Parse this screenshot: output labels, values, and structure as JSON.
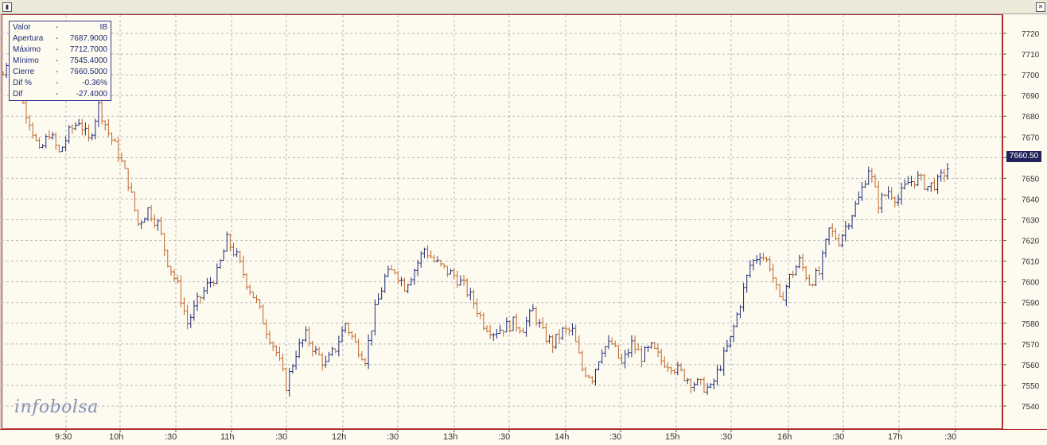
{
  "window": {
    "icon": "window-icon"
  },
  "info_box": {
    "rows": [
      {
        "label": "Valor",
        "value": "IB"
      },
      {
        "label": "Apertura",
        "value": "7687.9000"
      },
      {
        "label": "Máximo",
        "value": "7712.7000"
      },
      {
        "label": "Mínimo",
        "value": "7545.4000"
      },
      {
        "label": "Cierre",
        "value": "7660.5000"
      },
      {
        "label": "Dif %",
        "value": "-0.36%"
      },
      {
        "label": "Dif",
        "value": "-27.4000"
      }
    ]
  },
  "logo": {
    "part1": "info",
    "part2": "bolsa"
  },
  "last_price_label": "7660.50",
  "colors": {
    "up": "#1f2a7a",
    "down": "#c0652a",
    "grid": "#b8b8b8",
    "frame": "#b03030"
  },
  "chart_data": {
    "type": "ohlc",
    "y_ticks": [
      "7720",
      "7710",
      "7700",
      "7690",
      "7680",
      "7670",
      "7660",
      "7650",
      "7640",
      "7630",
      "7620",
      "7610",
      "7600",
      "7590",
      "7580",
      "7570",
      "7560",
      "7550",
      "7540"
    ],
    "ylim": [
      7535,
      7725
    ],
    "x_ticks": [
      "9:30",
      "10h",
      ":30",
      "11h",
      ":30",
      "12h",
      ":30",
      "13h",
      ":30",
      "14h",
      ":30",
      "15h",
      ":30",
      "16h",
      ":30",
      "17h",
      ":30"
    ],
    "open": 7687.9,
    "high": 7712.7,
    "low": 7545.4,
    "close": 7660.5,
    "path_points": [
      [
        0,
        7700
      ],
      [
        2,
        7712
      ],
      [
        5,
        7690
      ],
      [
        8,
        7678
      ],
      [
        11,
        7662
      ],
      [
        14,
        7672
      ],
      [
        17,
        7662
      ],
      [
        20,
        7672
      ],
      [
        23,
        7678
      ],
      [
        26,
        7668
      ],
      [
        29,
        7685
      ],
      [
        32,
        7672
      ],
      [
        35,
        7662
      ],
      [
        38,
        7648
      ],
      [
        41,
        7628
      ],
      [
        44,
        7635
      ],
      [
        47,
        7628
      ],
      [
        50,
        7610
      ],
      [
        53,
        7598
      ],
      [
        56,
        7580
      ],
      [
        59,
        7590
      ],
      [
        62,
        7598
      ],
      [
        65,
        7604
      ],
      [
        68,
        7620
      ],
      [
        71,
        7612
      ],
      [
        74,
        7600
      ],
      [
        77,
        7590
      ],
      [
        80,
        7577
      ],
      [
        83,
        7566
      ],
      [
        86,
        7550
      ],
      [
        89,
        7566
      ],
      [
        92,
        7574
      ],
      [
        95,
        7566
      ],
      [
        98,
        7560
      ],
      [
        101,
        7568
      ],
      [
        104,
        7580
      ],
      [
        107,
        7570
      ],
      [
        110,
        7563
      ],
      [
        113,
        7586
      ],
      [
        116,
        7602
      ],
      [
        119,
        7606
      ],
      [
        122,
        7598
      ],
      [
        125,
        7606
      ],
      [
        128,
        7616
      ],
      [
        131,
        7610
      ],
      [
        134,
        7606
      ],
      [
        137,
        7603
      ],
      [
        140,
        7598
      ],
      [
        143,
        7590
      ],
      [
        146,
        7580
      ],
      [
        149,
        7576
      ],
      [
        152,
        7578
      ],
      [
        155,
        7580
      ],
      [
        158,
        7578
      ],
      [
        161,
        7586
      ],
      [
        164,
        7575
      ],
      [
        167,
        7570
      ],
      [
        170,
        7576
      ],
      [
        173,
        7576
      ],
      [
        176,
        7558
      ],
      [
        179,
        7554
      ],
      [
        182,
        7568
      ],
      [
        185,
        7570
      ],
      [
        188,
        7560
      ],
      [
        191,
        7570
      ],
      [
        194,
        7564
      ],
      [
        197,
        7568
      ],
      [
        200,
        7562
      ],
      [
        203,
        7560
      ],
      [
        206,
        7556
      ],
      [
        209,
        7552
      ],
      [
        212,
        7550
      ],
      [
        215,
        7548
      ],
      [
        218,
        7560
      ],
      [
        221,
        7572
      ],
      [
        224,
        7590
      ],
      [
        227,
        7608
      ],
      [
        230,
        7614
      ],
      [
        233,
        7608
      ],
      [
        236,
        7590
      ],
      [
        239,
        7602
      ],
      [
        242,
        7610
      ],
      [
        245,
        7600
      ],
      [
        248,
        7604
      ],
      [
        251,
        7625
      ],
      [
        254,
        7620
      ],
      [
        257,
        7630
      ],
      [
        260,
        7640
      ],
      [
        263,
        7655
      ],
      [
        266,
        7638
      ],
      [
        269,
        7644
      ],
      [
        272,
        7640
      ],
      [
        275,
        7648
      ],
      [
        278,
        7650
      ],
      [
        281,
        7646
      ],
      [
        284,
        7648
      ],
      [
        287,
        7655
      ]
    ],
    "x_domain": [
      0,
      287
    ]
  }
}
